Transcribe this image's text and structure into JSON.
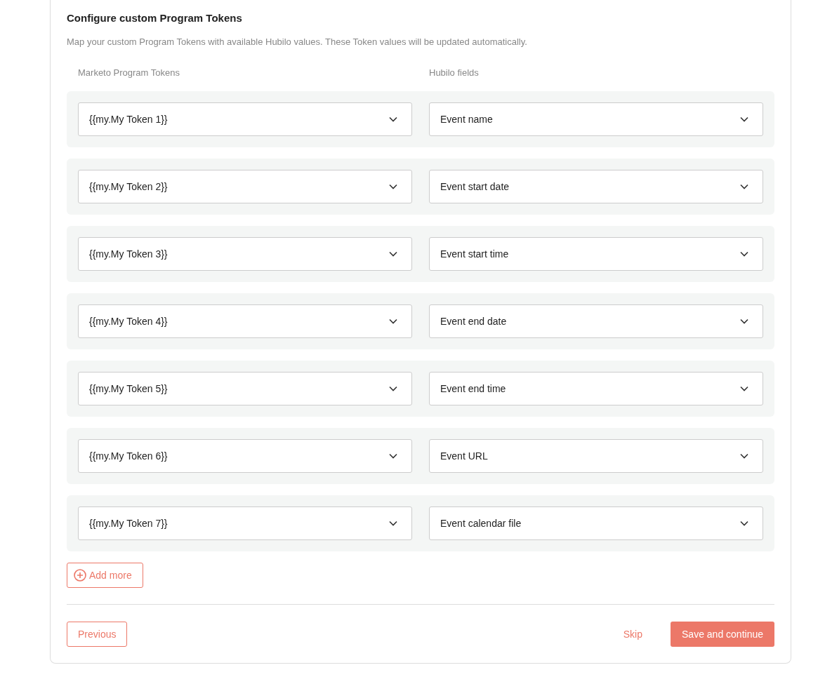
{
  "title": "Configure custom Program Tokens",
  "description": "Map your custom Program Tokens with available Hubilo values. These Token values will be updated automatically.",
  "columns": [
    "Marketo Program Tokens",
    "Hubilo fields"
  ],
  "mappings": [
    {
      "token": "{{my.My Token 1}}",
      "field": "Event name"
    },
    {
      "token": "{{my.My Token 2}}",
      "field": "Event start date"
    },
    {
      "token": "{{my.My Token 3}}",
      "field": "Event start time"
    },
    {
      "token": "{{my.My Token 4}}",
      "field": "Event end date"
    },
    {
      "token": "{{my.My Token 5}}",
      "field": "Event end time"
    },
    {
      "token": "{{my.My Token 6}}",
      "field": "Event URL"
    },
    {
      "token": "{{my.My Token 7}}",
      "field": "Event calendar file"
    }
  ],
  "add_button": "Add more",
  "footer": {
    "previous": "Previous",
    "skip": "Skip",
    "save": "Save and continue"
  }
}
